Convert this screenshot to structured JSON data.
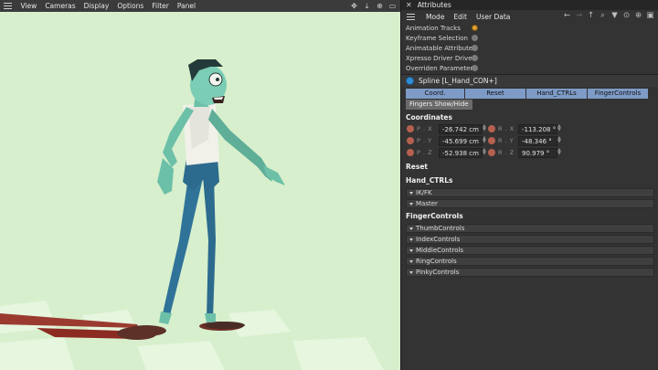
{
  "viewport": {
    "menu": [
      "View",
      "Cameras",
      "Display",
      "Options",
      "Filter",
      "Panel"
    ],
    "nav_icons": [
      "move-view-icon",
      "download-icon",
      "zoom-icon",
      "layout-icon"
    ],
    "colors": {
      "background": "#d7efcc",
      "floor_tile": "#e4f5dc",
      "skin": "#6cc0a8",
      "pants": "#2d6b8e",
      "shirt": "#f1f1ea",
      "shadow": "#8c2b22"
    }
  },
  "attributes": {
    "title": "Attributes",
    "toolbar_menu": [
      "Mode",
      "Edit",
      "User Data"
    ],
    "toolbar_icons": [
      "back-arrow-icon",
      "forward-arrow-icon",
      "up-arrow-icon",
      "search-icon",
      "filter-icon",
      "lock-icon",
      "add-icon",
      "new-window-icon"
    ],
    "modes": [
      {
        "label": "Animation Tracks",
        "active": true
      },
      {
        "label": "Keyframe Selection",
        "active": false
      },
      {
        "label": "Animatable Attributes",
        "active": false
      },
      {
        "label": "Xpresso Driver Driven",
        "active": false
      },
      {
        "label": "Overriden Parameters",
        "active": false
      }
    ],
    "object_name": "Spline [L_Hand_CON+]",
    "tabs": [
      "Coord.",
      "Reset",
      "Hand_CTRLs",
      "FingerControls"
    ],
    "tab2": "Fingers Show/Hide",
    "coordinates_title": "Coordinates",
    "coords": [
      {
        "plabel": "P . X",
        "pval": "-26.742 cm",
        "rlabel": "R . X",
        "rval": "-113.208 °"
      },
      {
        "plabel": "P . Y",
        "pval": "-45.699 cm",
        "rlabel": "R . Y",
        "rval": "-48.346 °"
      },
      {
        "plabel": "P . Z",
        "pval": "-52.938 cm",
        "rlabel": "R . Z",
        "rval": "90.979 °"
      }
    ],
    "reset_title": "Reset",
    "hand_title": "Hand_CTRLs",
    "hand_groups": [
      "IK/FK",
      "Master"
    ],
    "finger_title": "FingerControls",
    "finger_groups": [
      "ThumbControls",
      "IndexControls",
      "MiddleControls",
      "RingControls",
      "PinkyControls"
    ]
  }
}
